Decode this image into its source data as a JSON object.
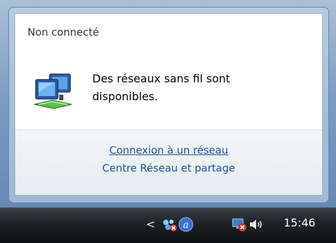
{
  "flyout": {
    "status_title": "Non connecté",
    "notice_line1": "Des réseaux sans fil sont",
    "notice_line2": "disponibles.",
    "links": {
      "connect": "Connexion à un réseau",
      "center": "Centre Réseau et partage"
    }
  },
  "taskbar": {
    "tray": {
      "expand_arrow": "<",
      "icons": [
        "network-disconnected-icon",
        "assistant-a-icon",
        "network-error-icon",
        "volume-icon"
      ],
      "clock": "15:46"
    }
  },
  "colors": {
    "link": "#1e4f9a",
    "taskbar": "#1d2126"
  }
}
